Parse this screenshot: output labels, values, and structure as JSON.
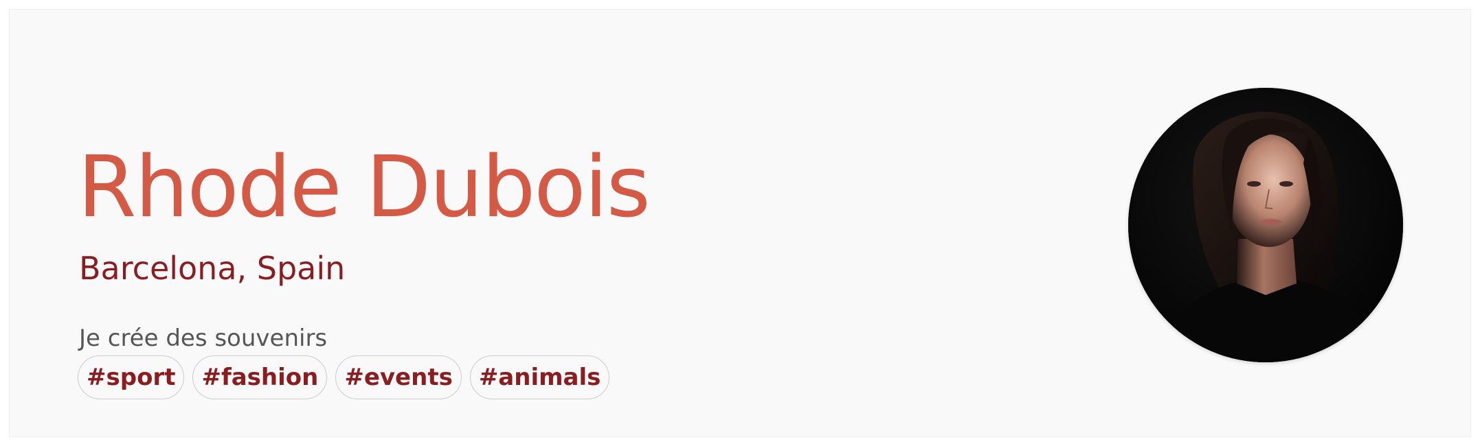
{
  "profile": {
    "name": "Rhode Dubois",
    "location": "Barcelona, Spain",
    "tagline": "Je crée des souvenirs",
    "tags": [
      "#sport",
      "#fashion",
      "#events",
      "#animals"
    ]
  },
  "colors": {
    "name": "#d45a46",
    "accent": "#8b1c1f",
    "tagline": "#555555",
    "card_background": "#f9f9f9"
  },
  "avatar": {
    "icon": "portrait-photo"
  }
}
